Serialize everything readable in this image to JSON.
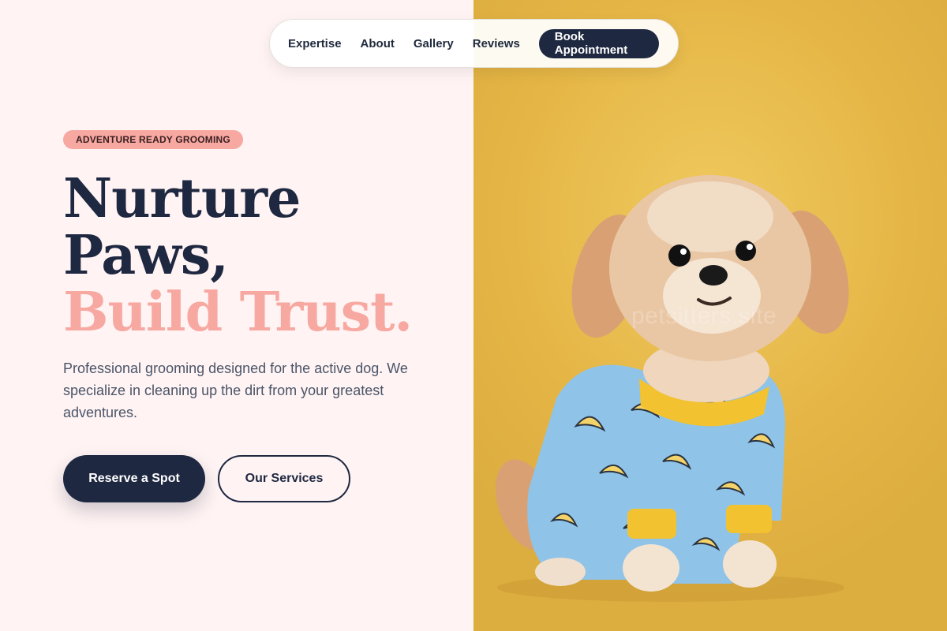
{
  "nav": {
    "links": [
      "Expertise",
      "About",
      "Gallery",
      "Reviews"
    ],
    "cta": "Book Appointment"
  },
  "hero": {
    "badge": "ADVENTURE READY GROOMING",
    "headline_line1": "Nurture",
    "headline_line2": "Paws,",
    "headline_line3": "Build Trust.",
    "description": "Professional grooming designed for the active dog. We specialize in cleaning up the dirt from your greatest adventures.",
    "primary_button": "Reserve a Spot",
    "secondary_button": "Our Services"
  },
  "image": {
    "subject": "puppy-in-banana-pajamas",
    "watermark": "petsitters.site"
  },
  "colors": {
    "navy": "#1e2841",
    "coral": "#f7a8a0",
    "background": "#fff3f3",
    "mustard": "#e8b94a",
    "pajama_blue": "#8fc3e8"
  }
}
